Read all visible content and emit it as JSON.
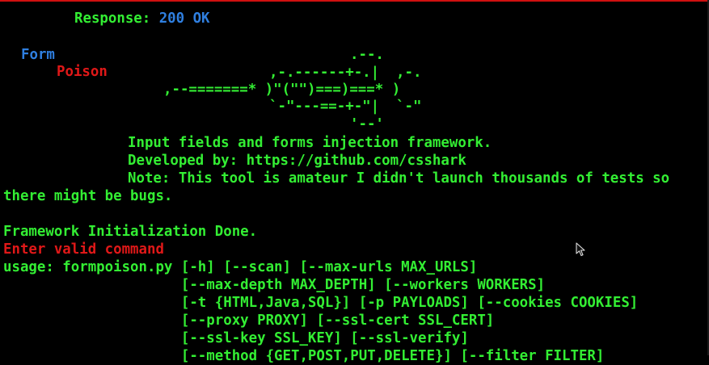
{
  "terminal": {
    "response_label": "Response: ",
    "response_code": "200 OK",
    "banner": {
      "form": "Form",
      "poison": "Poison",
      "art": [
        ".--.",
        ",-.------+-.|  ,-.",
        ",--=======* )\"(\"\")===)===* )",
        "`-\"---==-+-\"|  `-\"",
        "'--'"
      ]
    },
    "description": "Input fields and forms injection framework.",
    "developer": "Developed by: https://github.com/csshark",
    "note_line1": "Note: This tool is amateur I didn't launch thousands of tests so",
    "note_line2": "there might be bugs.",
    "init_message": "Framework Initialization Done.",
    "error_message": "Enter valid command",
    "usage": [
      "usage: formpoison.py [-h] [--scan] [--max-urls MAX_URLS]",
      "                     [--max-depth MAX_DEPTH] [--workers WORKERS]",
      "                     [-t {HTML,Java,SQL}] [-p PAYLOADS] [--cookies COOKIES]",
      "                     [--proxy PROXY] [--ssl-cert SSL_CERT]",
      "                     [--ssl-key SSL_KEY] [--ssl-verify]",
      "                     [--method {GET,POST,PUT,DELETE}] [--filter FILTER]"
    ],
    "colors": {
      "background": "#000000",
      "text_green": "#33ee33",
      "accent_blue": "#2f7fe0",
      "error_red": "#e01818"
    }
  }
}
